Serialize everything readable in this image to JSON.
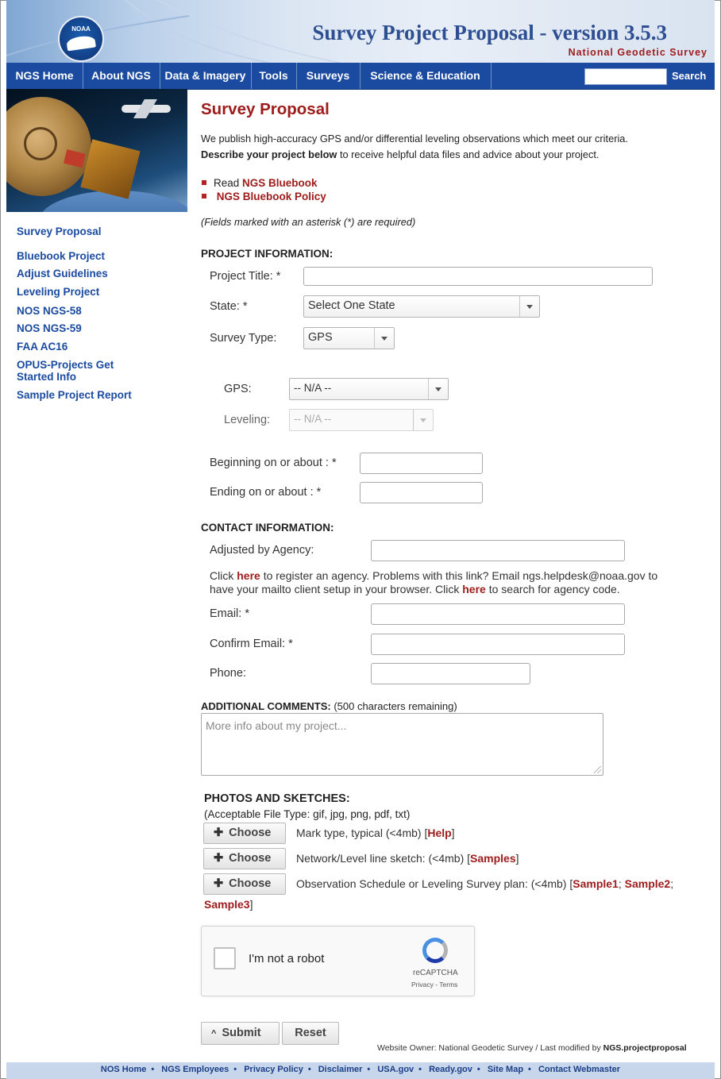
{
  "header": {
    "logo_text": "NOAA",
    "title": "Survey Project Proposal - version 3.5.3",
    "subtitle": "National Geodetic Survey"
  },
  "nav": {
    "items": [
      "NGS Home",
      "About NGS",
      "Data & Imagery",
      "Tools",
      "Surveys",
      "Science & Education"
    ],
    "search_label": "Search",
    "search_value": ""
  },
  "sidebar": {
    "links": [
      "Survey Proposal",
      "Bluebook Project",
      "Adjust Guidelines",
      "Leveling Project",
      "NOS NGS-58",
      "NOS NGS-59",
      "FAA AC16",
      "OPUS-Projects Get",
      "Started Info",
      "Sample Project Report"
    ]
  },
  "intro": {
    "title": "Survey Proposal",
    "line1": "We publish high-accuracy GPS and/or differential leveling observations which meet our criteria.",
    "line2_bold": "Describe your project below",
    "line2_rest": " to receive helpful data files and advice about your project.",
    "bullet1_prefix": "Read ",
    "bullet1_link": "NGS Bluebook",
    "bullet2_link": "NGS Bluebook Policy",
    "required_note": "(Fields marked with an asterisk (*) are required)"
  },
  "project": {
    "heading": "PROJECT INFORMATION:",
    "title_label": "Project Title:  *",
    "title_value": "",
    "state_label": "State:  *",
    "state_value": "Select One State",
    "survey_type_label": "Survey Type:",
    "survey_type_value": "GPS",
    "gps_label": "GPS:",
    "gps_value": "-- N/A --",
    "leveling_label": "Leveling:",
    "leveling_value": "-- N/A --",
    "begin_label": "Beginning on or about :  *",
    "end_label": "Ending on or about :  *"
  },
  "contact": {
    "heading": "CONTACT INFORMATION:",
    "agency_label": "Adjusted by Agency:",
    "help_1": "Click ",
    "help_link1": "here",
    "help_2": " to register an agency. Problems with this link? Email ngs.helpdesk@noaa.gov to",
    "help_3": "have your mailto client setup in your browser. Click ",
    "help_link2": "here",
    "help_4": " to search for agency code.",
    "email_label": "Email:  *",
    "confirm_label": "Confirm Email:  *",
    "phone_label": "Phone:"
  },
  "comments": {
    "heading": "ADDITIONAL COMMENTS:",
    "remaining": " (500 characters remaining)",
    "placeholder": "More info about my project..."
  },
  "photos": {
    "heading": "PHOTOS AND SKETCHES:",
    "file_types": "(Acceptable File Type: gif, jpg, png, pdf, txt)",
    "choose_label": "Choose",
    "row1_text": "Mark type, typical (<4mb) [",
    "row1_link": "Help",
    "row2_text": "Network/Level line sketch: (<4mb) [",
    "row2_link": "Samples",
    "row3_text": "Observation Schedule or Leveling Survey plan: (<4mb) [",
    "row3_link1": "Sample1",
    "row3_link2": "Sample2",
    "row3_link3": "Sample3"
  },
  "captcha": {
    "label": "I'm not a robot",
    "brand": "reCAPTCHA",
    "terms": "Privacy - Terms"
  },
  "actions": {
    "submit_label": "Submit",
    "reset_label": "Reset"
  },
  "footer": {
    "owner": "Website Owner: National Geodetic Survey  /  Last modified by ",
    "owner_bold": "NGS.projectproposal",
    "links": [
      "NOS Home",
      "NGS Employees",
      "Privacy Policy",
      "Disclaimer",
      "USA.gov",
      "Ready.gov",
      "Site Map",
      "Contact Webmaster"
    ]
  }
}
